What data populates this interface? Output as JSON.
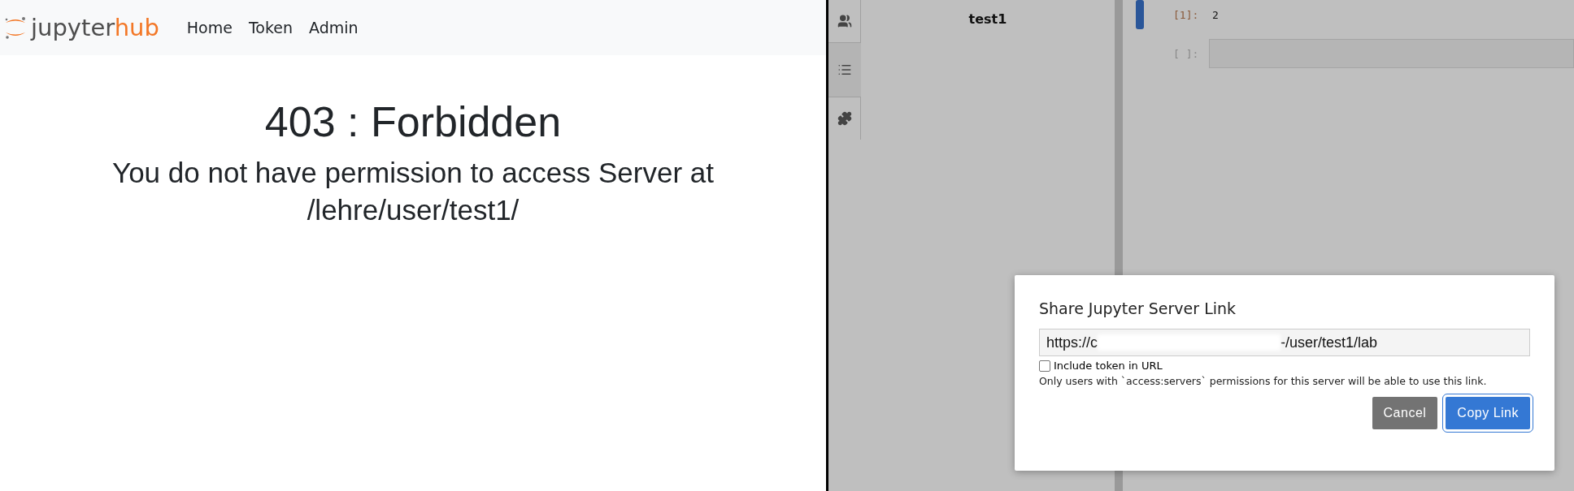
{
  "hub": {
    "logo": {
      "left": "jupyter",
      "right": "hub"
    },
    "nav": [
      "Home",
      "Token",
      "Admin"
    ],
    "error": {
      "title": "403 : Forbidden",
      "message": "You do not have permission to access Server at /lehre/user/test1/"
    }
  },
  "lab": {
    "sidebar_tabs": [
      {
        "kind": "users",
        "selected": false
      },
      {
        "kind": "list",
        "selected": true
      },
      {
        "kind": "puzzle",
        "selected": false
      }
    ],
    "panel_title": "test1",
    "cells": [
      {
        "prompt": "[1]:",
        "output": "2",
        "active": true
      },
      {
        "prompt": "[ ]:",
        "active": false
      }
    ],
    "dialog": {
      "title": "Share Jupyter Server Link",
      "url_start": "https://c",
      "url_end": "-/user/test1/lab",
      "checkbox": {
        "label": "Include token in URL",
        "checked": false
      },
      "note": "Only users with `access:servers` permissions for this server will be able to use this link.",
      "buttons": [
        {
          "label": "Cancel",
          "kind": "secondary"
        },
        {
          "label": "Copy Link",
          "kind": "primary"
        }
      ]
    }
  }
}
